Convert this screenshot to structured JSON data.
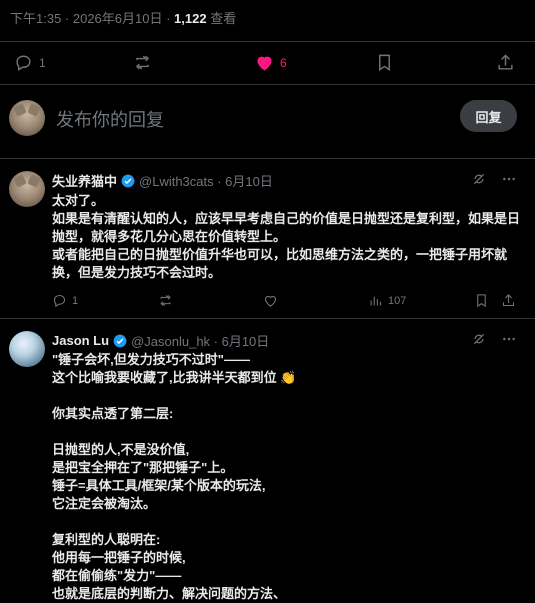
{
  "post_meta": {
    "time_date": "下午1:35 · 2026年6月10日 · ",
    "views_count": "1,122",
    "views_label": " 查看"
  },
  "actions": {
    "reply_count": "1",
    "like_count": "6",
    "like_color": "#f91880"
  },
  "reply_box": {
    "placeholder": "发布你的回复",
    "button_label": "回复"
  },
  "tweets": [
    {
      "name": "失业养猫中",
      "handle": "@Lwith3cats · 6月10日",
      "text": "太对了。\n如果是有清醒认知的人，应该早早考虑自己的价值是日抛型还是复利型，如果是日抛型，就得多花几分心思在价值转型上。\n或者能把自己的日抛型价值升华也可以，比如思维方法之类的，一把锤子用坏就换，但是发力技巧不会过时。",
      "reply_count": "1",
      "views": "107"
    },
    {
      "name": "Jason Lu",
      "handle": "@Jasonlu_hk · 6月10日",
      "text": "\"锤子会坏,但发力技巧不过时\"——\n这个比喻我要收藏了,比我讲半天都到位 👏\n\n你其实点透了第二层:\n\n日抛型的人,不是没价值,\n是把宝全押在了\"那把锤子\"上。\n锤子=具体工具/框架/某个版本的玩法,\n它注定会被淘汰。\n\n复利型的人聪明在:\n他用每一把锤子的时候,\n都在偷偷练\"发力\"——\n也就是底层的判断力、解决问题的方法、"
    }
  ]
}
